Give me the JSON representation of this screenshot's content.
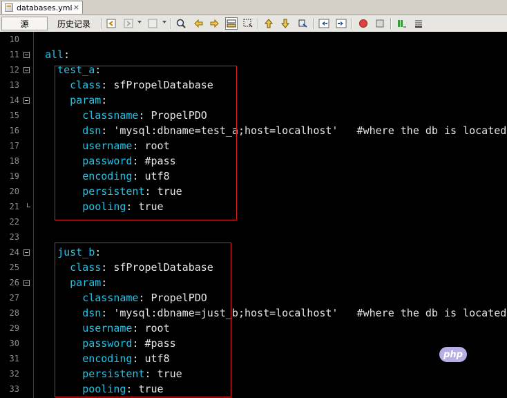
{
  "tab": {
    "filename": "databases.yml",
    "close": "×"
  },
  "toolbar": {
    "source_label": "源",
    "history_label": "历史记录",
    "icons": [
      "back-icon",
      "forward-icon",
      "find-prev-icon",
      "search-icon",
      "find-previous-icon",
      "find-next-icon",
      "toggle-highlight-icon",
      "select-icon",
      "prev-bookmark-icon",
      "next-bookmark-icon",
      "toggle-bookmark-icon",
      "shift-left-icon",
      "shift-right-icon",
      "record-macro-icon",
      "stop-macro-icon",
      "check-icon",
      "comment-icon"
    ]
  },
  "line_numbers": [
    "10",
    "11",
    "12",
    "13",
    "14",
    "15",
    "16",
    "17",
    "18",
    "19",
    "20",
    "21",
    "22",
    "23",
    "24",
    "25",
    "26",
    "27",
    "28",
    "29",
    "30",
    "31",
    "32",
    "33"
  ],
  "code": {
    "all_key": "all",
    "test_a": {
      "name": "test_a",
      "class_key": "class",
      "class_val": "sfPropelDatabase",
      "param_key": "param",
      "classname_key": "classname",
      "classname_val": "PropelPDO",
      "dsn_key": "dsn",
      "dsn_val": "'mysql:dbname=test_a;host=localhost'",
      "dsn_comment": "#where the db is located",
      "username_key": "username",
      "username_val": "root",
      "password_key": "password",
      "password_val": "#pass",
      "encoding_key": "encoding",
      "encoding_val": "utf8",
      "persistent_key": "persistent",
      "persistent_val": "true",
      "pooling_key": "pooling",
      "pooling_val": "true"
    },
    "just_b": {
      "name": "just_b",
      "class_key": "class",
      "class_val": "sfPropelDatabase",
      "param_key": "param",
      "classname_key": "classname",
      "classname_val": "PropelPDO",
      "dsn_key": "dsn",
      "dsn_val": "'mysql:dbname=just_b;host=localhost'",
      "dsn_comment": "#where the db is located",
      "username_key": "username",
      "username_val": "root",
      "password_key": "password",
      "password_val": "#pass",
      "encoding_key": "encoding",
      "encoding_val": "utf8",
      "persistent_key": "persistent",
      "persistent_val": "true",
      "pooling_key": "pooling",
      "pooling_val": "true"
    }
  },
  "colors": {
    "key": "#22c3e6",
    "text": "#e6e6e6",
    "line_number": "#8f8f8f",
    "highlight_box": "#e02020",
    "background": "#000000"
  },
  "watermark": {
    "text": "php"
  }
}
